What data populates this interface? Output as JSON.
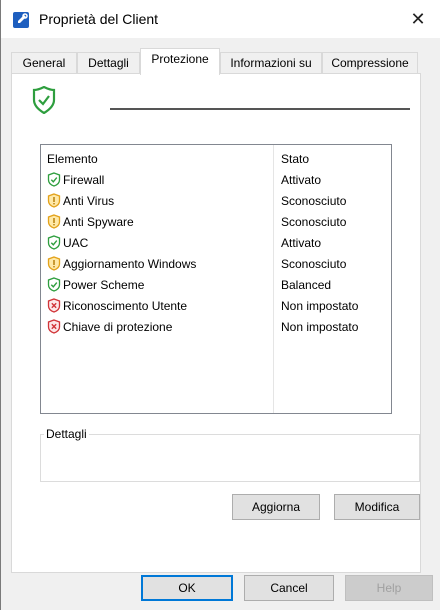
{
  "window": {
    "title": "Proprietà del Client",
    "close_glyph": "✕"
  },
  "tabs": [
    {
      "label": "General"
    },
    {
      "label": "Dettagli"
    },
    {
      "label": "Protezione",
      "active": true
    },
    {
      "label": "Informazioni su"
    },
    {
      "label": "Compressione"
    }
  ],
  "list": {
    "columns": {
      "element": "Elemento",
      "state": "Stato"
    },
    "rows": [
      {
        "name": "Firewall",
        "state": "Attivato",
        "icon": "shield-check-icon"
      },
      {
        "name": "Anti Virus",
        "state": "Sconosciuto",
        "icon": "shield-warning-icon"
      },
      {
        "name": "Anti Spyware",
        "state": "Sconosciuto",
        "icon": "shield-warning-icon"
      },
      {
        "name": "UAC",
        "state": "Attivato",
        "icon": "shield-check-icon"
      },
      {
        "name": "Aggiornamento Windows",
        "state": "Sconosciuto",
        "icon": "shield-warning-icon"
      },
      {
        "name": "Power Scheme",
        "state": "Balanced",
        "icon": "shield-check-icon"
      },
      {
        "name": "Riconoscimento Utente",
        "state": "Non impostato",
        "icon": "shield-error-icon"
      },
      {
        "name": "Chiave di protezione",
        "state": "Non impostato",
        "icon": "shield-error-icon"
      }
    ]
  },
  "details": {
    "title": "Dettagli"
  },
  "actions": {
    "refresh": "Aggiorna",
    "modify": "Modifica"
  },
  "footer": {
    "ok": "OK",
    "cancel": "Cancel",
    "help": "Help"
  },
  "colors": {
    "ok_green": "#2e9e3e",
    "warn_yellow": "#e3a21a",
    "error_red": "#d13438",
    "accent": "#0078d7"
  }
}
